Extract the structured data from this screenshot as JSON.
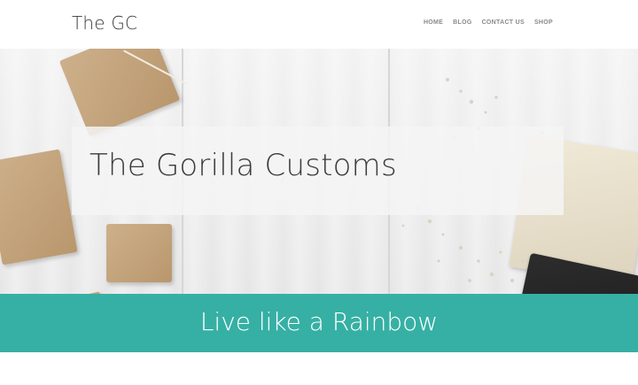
{
  "header": {
    "logo": "The GC",
    "nav": [
      {
        "label": "HOME"
      },
      {
        "label": "BLOG"
      },
      {
        "label": "CONTACT US"
      },
      {
        "label": "SHOP"
      }
    ]
  },
  "hero": {
    "title": "The Gorilla Customs"
  },
  "banner": {
    "text": "Live like a Rainbow",
    "color": "#36b0a4"
  }
}
